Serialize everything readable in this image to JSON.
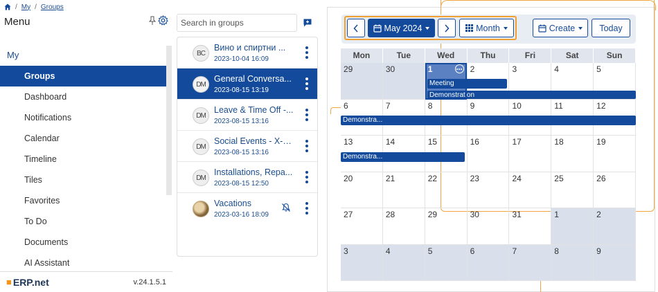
{
  "breadcrumb": {
    "items": [
      "My",
      "Groups"
    ]
  },
  "sidebar": {
    "title": "Menu",
    "section": "My",
    "items": [
      {
        "label": "Groups",
        "active": true
      },
      {
        "label": "Dashboard"
      },
      {
        "label": "Notifications"
      },
      {
        "label": "Calendar"
      },
      {
        "label": "Timeline"
      },
      {
        "label": "Tiles"
      },
      {
        "label": "Favorites"
      },
      {
        "label": "To Do"
      },
      {
        "label": "Documents"
      },
      {
        "label": "AI Assistant"
      }
    ],
    "logo": "ERP.net",
    "version": "v.24.1.5.1"
  },
  "groups": {
    "search_placeholder": "Search in groups",
    "items": [
      {
        "title": "Вино и спиртни ...",
        "date": "2023-10-04 16:09",
        "avatar": "BC"
      },
      {
        "title": "General Conversa...",
        "date": "2023-08-15 13:19",
        "avatar": "DM",
        "active": true
      },
      {
        "title": "Leave & Time Off -...",
        "date": "2023-08-15 13:16",
        "avatar": "DM"
      },
      {
        "title": "Social Events - X-T...",
        "date": "2023-08-15 13:16",
        "avatar": "DM"
      },
      {
        "title": "Installations, Repa...",
        "date": "2023-08-15 12:50",
        "avatar": "DM"
      },
      {
        "title": "Vacations",
        "date": "2023-03-16 18:09",
        "avatar": "",
        "muted": true
      }
    ]
  },
  "calendar": {
    "month_label": "May 2024",
    "view_label": "Month",
    "create_label": "Create",
    "today_label": "Today",
    "days_of_week": [
      "Mon",
      "Tue",
      "Wed",
      "Thu",
      "Fri",
      "Sat",
      "Sun"
    ],
    "weeks": [
      [
        "29",
        "30",
        "1",
        "2",
        "3",
        "4",
        "5"
      ],
      [
        "6",
        "7",
        "8",
        "9",
        "10",
        "11",
        "12"
      ],
      [
        "13",
        "14",
        "15",
        "16",
        "17",
        "18",
        "19"
      ],
      [
        "20",
        "21",
        "22",
        "23",
        "24",
        "25",
        "26"
      ],
      [
        "27",
        "28",
        "29",
        "30",
        "31",
        "1",
        "2"
      ],
      [
        "3",
        "4",
        "5",
        "6",
        "7",
        "8",
        "9"
      ]
    ],
    "events": {
      "meeting": "Meeting",
      "demo_week1": "Demonstration",
      "demo_week2": "Demonstra...",
      "demo_week3": "Demonstra..."
    },
    "colors": {
      "accent": "#134a9c",
      "today_bg": "#5c81c2",
      "other_month_bg": "#d9e0ec",
      "highlight": "#f0a030"
    }
  }
}
